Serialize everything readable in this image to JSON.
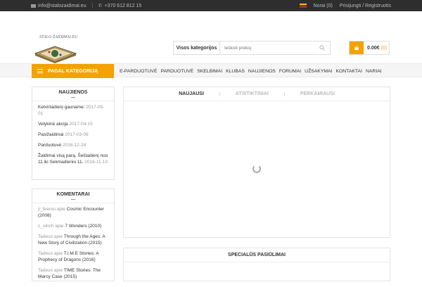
{
  "topbar": {
    "email": "info@stalozaidimai.eu",
    "phone": "+370 612 812 15",
    "wishlist": "Norai (0)",
    "login": "Prisijungti / Registruotis"
  },
  "header": {
    "logo_text": "STALO ŽAIDIMAI.EU",
    "search_category": "Visos kategorijos",
    "search_placeholder": "Ieškoti prekių",
    "cart_total": "0.00€",
    "cart_count": "(0)"
  },
  "nav": {
    "categories_button": "PAGAL KATEGORIJĄ",
    "items": [
      "E-PARDUOTUVĖ",
      "PARDUOTUVĖ",
      "SKELBIMAI",
      "KLUBAS",
      "NAUJIENOS",
      "FORUMAI",
      "UŽSAKYMAI",
      "KONTAKTAI",
      "NARIAI"
    ]
  },
  "news": {
    "title": "NAUJIENOS",
    "items": [
      {
        "text": "Ketvirtadienį gauname:",
        "date": "2017-05-01"
      },
      {
        "text": "Velykinė akcija",
        "date": "2017-04-15"
      },
      {
        "text": "Pasižaidimai",
        "date": "2017-03-09"
      },
      {
        "text": "Parduotuvė",
        "date": "2016-12-24"
      },
      {
        "text": "Žaidimai visą parą. Šeštadienį nuo 11 iki Sekmadienio 11.",
        "date": "2016-11-13"
      }
    ]
  },
  "comments": {
    "title": "KOMENTARAI",
    "items": [
      {
        "author": "ji_fearou apie",
        "game": "Cosmic Encounter (2008)"
      },
      {
        "author": "c_ulrich apie",
        "game": "7 Wonders (2010)"
      },
      {
        "author": "Tadeus apie",
        "game": "Through the Ages: A New Story of Civilization (2015)"
      },
      {
        "author": "Tadeus apie",
        "game": "T.I.M.E Stories: A Prophecy of Dragons (2016)"
      },
      {
        "author": "Tadeus apie",
        "game": "TIME Stories: The Marcy Case (2015)"
      }
    ]
  },
  "products": {
    "tabs": [
      "NAUJAUSI",
      "ATSITIKTINIAI",
      "PERKAMIAUSI"
    ]
  },
  "special": {
    "title": "SPECIALŪS PASIŪLIMAI"
  },
  "colors": {
    "accent": "#f5a100",
    "topbar": "#2e2e2e"
  }
}
